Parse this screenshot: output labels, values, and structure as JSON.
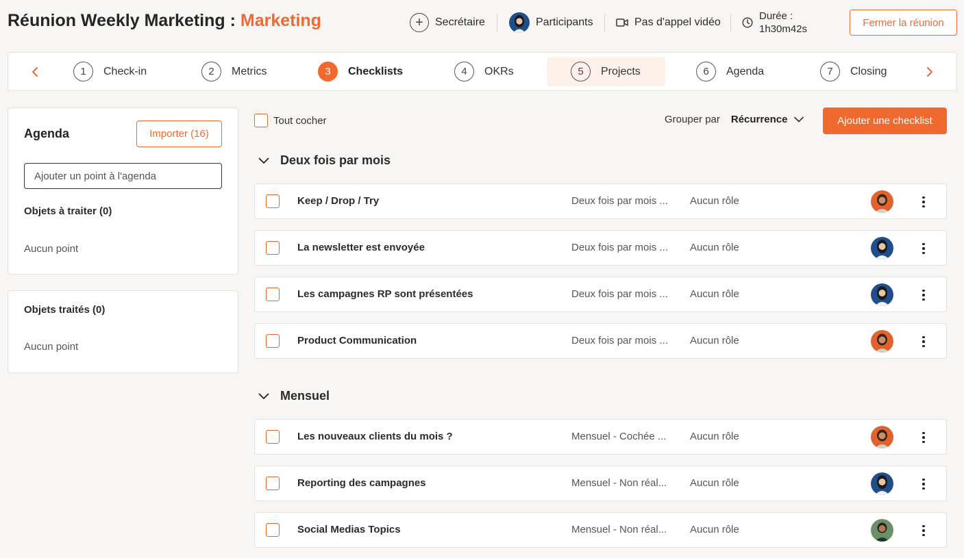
{
  "header": {
    "title_prefix": "Réunion Weekly Marketing : ",
    "title_team": "Marketing",
    "secretary_label": "Secrétaire",
    "participants_label": "Participants",
    "video_label": "Pas d'appel vidéo",
    "duration_label": "Durée :",
    "duration_value": "1h30m42s",
    "close_button": "Fermer la réunion"
  },
  "steps": [
    {
      "num": "1",
      "label": "Check-in"
    },
    {
      "num": "2",
      "label": "Metrics"
    },
    {
      "num": "3",
      "label": "Checklists"
    },
    {
      "num": "4",
      "label": "OKRs"
    },
    {
      "num": "5",
      "label": "Projects"
    },
    {
      "num": "6",
      "label": "Agenda"
    },
    {
      "num": "7",
      "label": "Closing"
    }
  ],
  "active_step": "3",
  "sidebar": {
    "agenda_title": "Agenda",
    "import_button": "Importer (16)",
    "agenda_input_placeholder": "Ajouter un point à l'agenda",
    "pending_label": "Objets à traiter (0)",
    "pending_empty": "Aucun point",
    "done_label": "Objets traités (0)",
    "done_empty": "Aucun point"
  },
  "toolbar": {
    "check_all": "Tout cocher",
    "group_by_label": "Grouper par",
    "group_by_value": "Récurrence",
    "add_button": "Ajouter une checklist"
  },
  "groups": [
    {
      "title": "Deux fois par mois",
      "rows": [
        {
          "name": "Keep / Drop / Try",
          "recurrence": "Deux fois par mois ...",
          "role": "Aucun rôle",
          "avatar": "orange"
        },
        {
          "name": "La newsletter est envoyée",
          "recurrence": "Deux fois par mois ...",
          "role": "Aucun rôle",
          "avatar": "blue"
        },
        {
          "name": "Les campagnes RP sont présentées",
          "recurrence": "Deux fois par mois ...",
          "role": "Aucun rôle",
          "avatar": "blue"
        },
        {
          "name": "Product Communication",
          "recurrence": "Deux fois par mois ...",
          "role": "Aucun rôle",
          "avatar": "orange"
        }
      ]
    },
    {
      "title": "Mensuel",
      "rows": [
        {
          "name": "Les nouveaux clients du mois ?",
          "recurrence": "Mensuel - Cochée ...",
          "role": "Aucun rôle",
          "avatar": "orange"
        },
        {
          "name": "Reporting des campagnes",
          "recurrence": "Mensuel - Non réal...",
          "role": "Aucun rôle",
          "avatar": "blue"
        },
        {
          "name": "Social Medias Topics",
          "recurrence": "Mensuel - Non réal...",
          "role": "Aucun rôle",
          "avatar": "green"
        }
      ]
    }
  ],
  "colors": {
    "accent": "#f06a2f",
    "avatar_orange": "#e2622e",
    "avatar_blue": "#1f4e8a",
    "avatar_green": "#6b8f6a"
  }
}
